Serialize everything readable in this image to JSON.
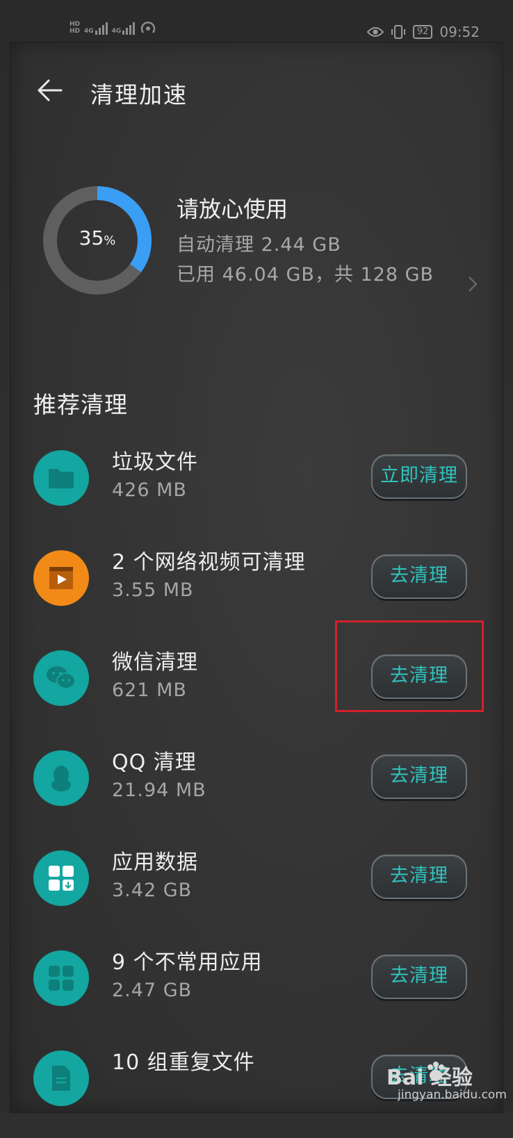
{
  "status_bar": {
    "hd1": "HD",
    "hd2": "HD",
    "net1": "4G",
    "net2": "4G",
    "battery": "92",
    "time": "09:52"
  },
  "header": {
    "title": "清理加速"
  },
  "storage": {
    "percent": "35",
    "percent_unit": "%",
    "percent_value": 0.35,
    "status_title": "请放心使用",
    "auto_clean": "自动清理  2.44  GB",
    "used_total": "已用  46.04  GB，共  128  GB"
  },
  "section": {
    "title": "推荐清理"
  },
  "items": [
    {
      "name": "垃圾文件",
      "size": "426  MB",
      "button": "立即清理",
      "icon": "folder-icon"
    },
    {
      "name": "2  个网络视频可清理",
      "size": "3.55  MB",
      "button": "去清理",
      "icon": "video-icon"
    },
    {
      "name": "微信清理",
      "size": "621  MB",
      "button": "去清理",
      "icon": "wechat-icon"
    },
    {
      "name": "QQ  清理",
      "size": "21.94  MB",
      "button": "去清理",
      "icon": "qq-icon"
    },
    {
      "name": "应用数据",
      "size": "3.42  GB",
      "button": "去清理",
      "icon": "app-data-icon"
    },
    {
      "name": "9  个不常用应用",
      "size": "2.47  GB",
      "button": "去清理",
      "icon": "apps-grid-icon"
    },
    {
      "name": "10  组重复文件",
      "size": "",
      "button": "去清理",
      "icon": "duplicate-file-icon"
    }
  ],
  "watermark": {
    "main": "Bai  经验",
    "sub": "jingyan.baidu.com"
  },
  "colors": {
    "accent": "#2fc4c0",
    "ring_progress": "#3a9ef5",
    "icon_teal": "#14a6a0",
    "icon_orange": "#f28a18",
    "highlight": "#d4202a"
  }
}
